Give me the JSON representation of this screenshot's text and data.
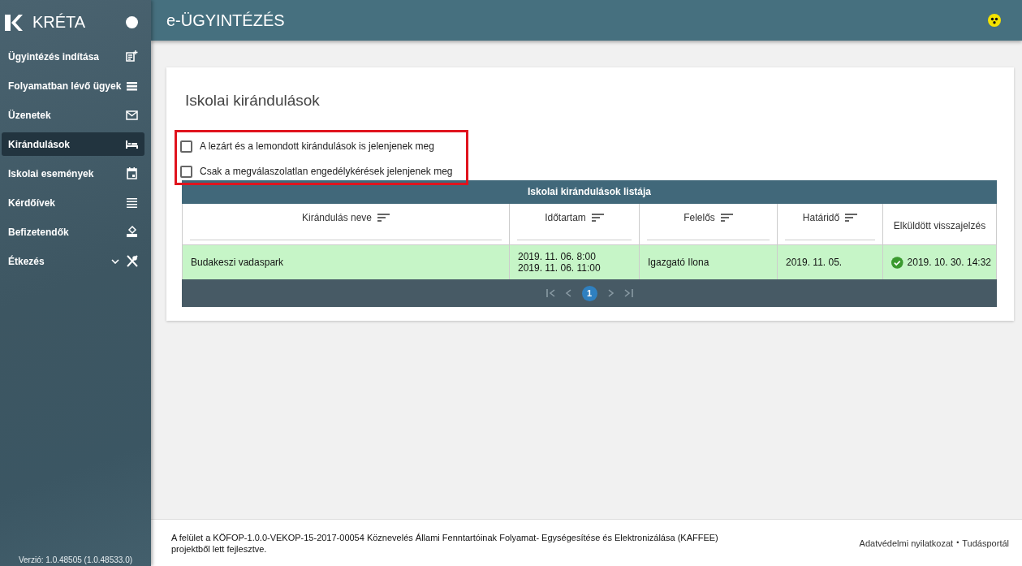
{
  "sidebar": {
    "logo_text": "KRÉTA",
    "items": [
      {
        "label": "Ügyintézés indítása",
        "selected": false,
        "expandable": false
      },
      {
        "label": "Folyamatban lévő ügyek",
        "selected": false,
        "expandable": false
      },
      {
        "label": "Üzenetek",
        "selected": false,
        "expandable": false
      },
      {
        "label": "Kirándulások",
        "selected": true,
        "expandable": false
      },
      {
        "label": "Iskolai események",
        "selected": false,
        "expandable": false
      },
      {
        "label": "Kérdőívek",
        "selected": false,
        "expandable": false
      },
      {
        "label": "Befizetendők",
        "selected": false,
        "expandable": false
      },
      {
        "label": "Étkezés",
        "selected": false,
        "expandable": true
      }
    ],
    "version": "Verzió: 1.0.48505 (1.0.48533.0)"
  },
  "topbar": {
    "title": "e-ÜGYINTÉZÉS"
  },
  "page": {
    "title": "Iskolai kirándulások",
    "filters": [
      {
        "label": "A lezárt és a lemondott kirándulások is jelenjenek meg",
        "checked": false
      },
      {
        "label": "Csak a megválaszolatlan engedélykérések jelenjenek meg",
        "checked": false
      }
    ],
    "table": {
      "caption": "Iskolai kirándulások listája",
      "columns": [
        {
          "label": "Kirándulás neve",
          "sortable": true
        },
        {
          "label": "Időtartam",
          "sortable": true
        },
        {
          "label": "Felelős",
          "sortable": true
        },
        {
          "label": "Határidő",
          "sortable": true
        },
        {
          "label": "Elküldött visszajelzés",
          "sortable": false
        }
      ],
      "rows": [
        {
          "cells": [
            "Budakeszi vadaspark",
            [
              "2019. 11. 06. 8:00",
              "2019. 11. 06. 11:00"
            ],
            "Igazgató Ilona",
            "2019. 11. 05.",
            "2019. 10. 30. 14:32"
          ],
          "feedback_sent": true
        }
      ],
      "pages": [
        {
          "label": "1",
          "selected": true
        }
      ]
    }
  },
  "footer": {
    "text": "A felület a KÖFOP-1.0.0-VEKOP-15-2017-00054 Köznevelés Állami Fenntartóinak Folyamat- Egységesítése és Elektronizálása (KAFFEE) projektből lett fejlesztve.",
    "links": [
      "Adatvédelmi nyilatkozat",
      "Tudásportál"
    ],
    "separator": "•"
  }
}
